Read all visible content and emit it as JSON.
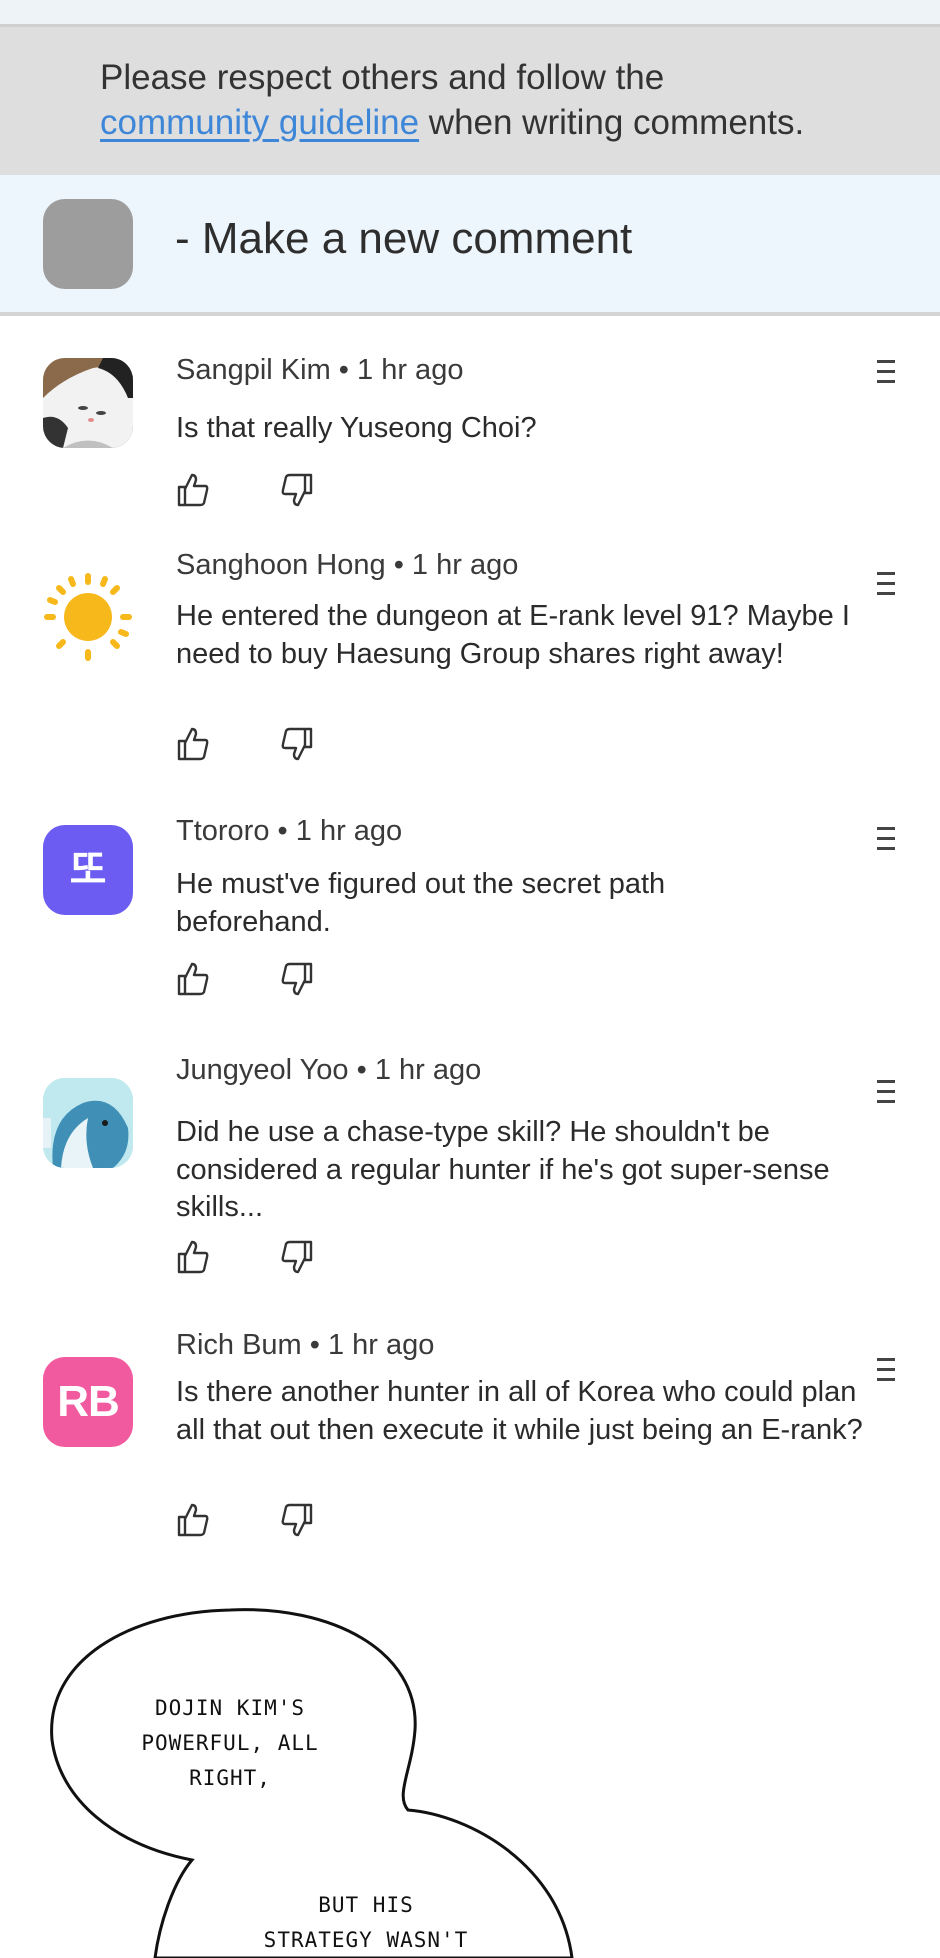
{
  "notice": {
    "line1": "Please respect others and follow the",
    "link": "community guideline",
    "line2_rest": " when writing comments."
  },
  "new_comment": {
    "label": "- Make a new comment"
  },
  "comments": [
    {
      "author": "Sangpil Kim",
      "time": "1 hr ago",
      "text": "Is that really Yuseong Choi?",
      "avatar": "cat-avatar"
    },
    {
      "author": "Sanghoon Hong",
      "time": "1 hr ago",
      "text": "He entered the dungeon at E-rank level 91? Maybe I need to buy Haesung Group shares right away!",
      "avatar": "sun-avatar"
    },
    {
      "author": "Ttororo",
      "time": "1 hr ago",
      "text": "He must've figured out the secret path beforehand.",
      "avatar": "letter-avatar",
      "avatar_text": "또"
    },
    {
      "author": "Jungyeol Yoo",
      "time": "1 hr ago",
      "text": "Did he use a chase-type skill? He shouldn't be considered a regular hunter if he's got super-sense skills...",
      "avatar": "whale-avatar"
    },
    {
      "author": "Rich Bum",
      "time": "1 hr ago",
      "text": "Is there another hunter in all of Korea who could plan all that out then execute it while just being an E-rank?",
      "avatar": "initials-avatar",
      "avatar_text": "RB"
    }
  ],
  "separator": " • ",
  "bubble": {
    "text1_line1": "DOJIN KIM'S",
    "text1_line2": "POWERFUL, ALL",
    "text1_line3": "RIGHT,",
    "text2_line1": "BUT HIS",
    "text2_line2": "STRATEGY WASN'T"
  },
  "colors": {
    "link": "#3d86d8",
    "notice_bg": "#dedede",
    "new_comment_bg": "#eef6fd",
    "rb_avatar": "#f25a9f",
    "tt_avatar": "#6c5cf2"
  }
}
